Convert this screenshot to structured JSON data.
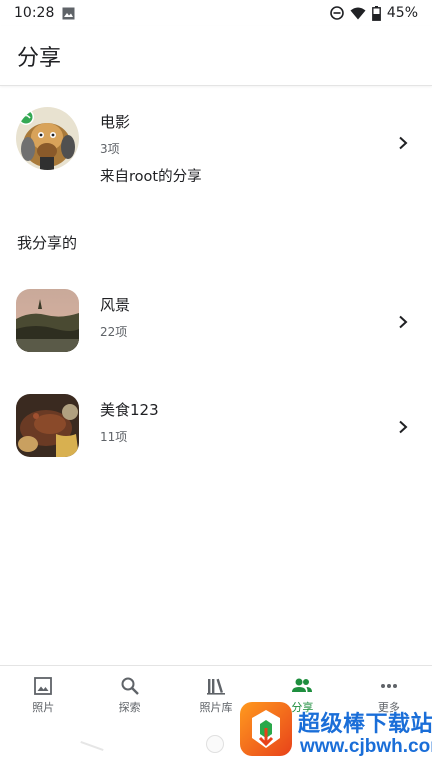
{
  "status_bar": {
    "time": "10:28",
    "battery": "45%"
  },
  "header": {
    "title": "分享"
  },
  "shared_with_me": [
    {
      "name": "电影",
      "count": "3项",
      "owner": "来自root的分享",
      "thumb": "cartoon-animals"
    }
  ],
  "my_shares": {
    "heading": "我分享的",
    "albums": [
      {
        "name": "风景",
        "count": "22项",
        "thumb": "landscape-sunset"
      },
      {
        "name": "美食123",
        "count": "11项",
        "thumb": "food-dish"
      }
    ]
  },
  "bottom_nav": {
    "items": [
      {
        "label": "照片",
        "icon": "photo-icon",
        "active": false
      },
      {
        "label": "探索",
        "icon": "search-icon",
        "active": false
      },
      {
        "label": "照片库",
        "icon": "library-icon",
        "active": false
      },
      {
        "label": "分享",
        "icon": "people-icon",
        "active": true
      },
      {
        "label": "更多",
        "icon": "more-icon",
        "active": false
      }
    ]
  },
  "watermark": {
    "title": "超级棒下载站",
    "url": "www.cjbwh.com"
  },
  "colors": {
    "accent": "#1e8e3e",
    "text": "#202124",
    "secondary": "#5f6368",
    "watermark": "#1a6ed8"
  }
}
